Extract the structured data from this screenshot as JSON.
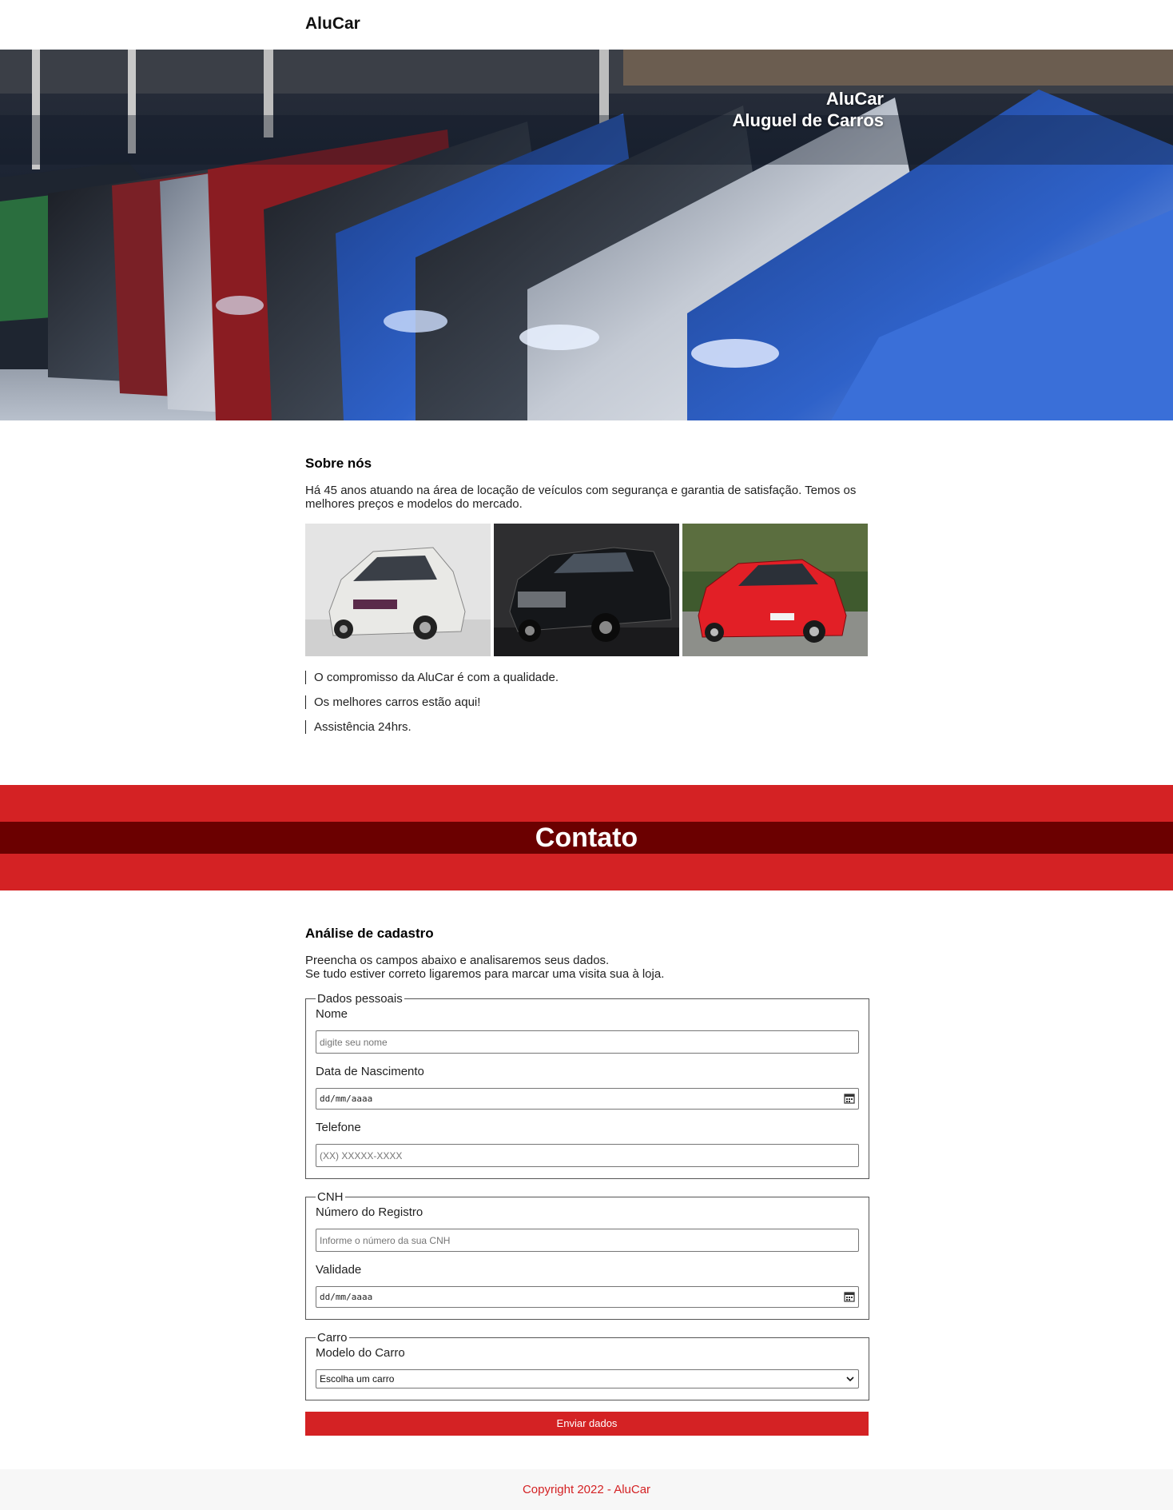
{
  "header": {
    "brand": "AluCar"
  },
  "hero": {
    "title_line1": "AluCar",
    "title_line2": "Aluguel de Carros",
    "image_icon": "car-lineup-photo"
  },
  "about": {
    "heading": "Sobre nós",
    "text": "Há 45 anos atuando na área de locação de veículos com segurança e garantia de satisfação. Temos os melhores preços e modelos do mercado.",
    "photos": [
      "white-compact-car-photo",
      "black-pickup-truck-photo",
      "red-hatchback-car-photo"
    ],
    "bullets": [
      "O compromisso da AluCar é com a qualidade.",
      "Os melhores carros estão aqui!",
      "Assistência 24hrs."
    ]
  },
  "contact_band": {
    "title": "Contato"
  },
  "form": {
    "heading": "Análise de cadastro",
    "intro_line1": "Preencha os campos abaixo e analisaremos seus dados.",
    "intro_line2": "Se tudo estiver correto ligaremos para marcar uma visita sua à loja.",
    "personal": {
      "legend": "Dados pessoais",
      "name_label": "Nome",
      "name_placeholder": "digite seu nome",
      "birth_label": "Data de Nascimento",
      "birth_value": "dd/mm/aaaa",
      "phone_label": "Telefone",
      "phone_placeholder": "(XX) XXXXX-XXXX"
    },
    "cnh": {
      "legend": "CNH",
      "number_label": "Número do Registro",
      "number_placeholder": "Informe o número da sua CNH",
      "validity_label": "Validade",
      "validity_value": "dd/mm/aaaa"
    },
    "car": {
      "legend": "Carro",
      "model_label": "Modelo do Carro",
      "model_selected": "Escolha um carro"
    },
    "submit_label": "Enviar dados"
  },
  "footer": {
    "copyright": "Copyright 2022 - AluCar"
  },
  "colors": {
    "accent": "#d42224",
    "band_strip": "#6b0000",
    "footer_bg": "#f7f7f7"
  }
}
